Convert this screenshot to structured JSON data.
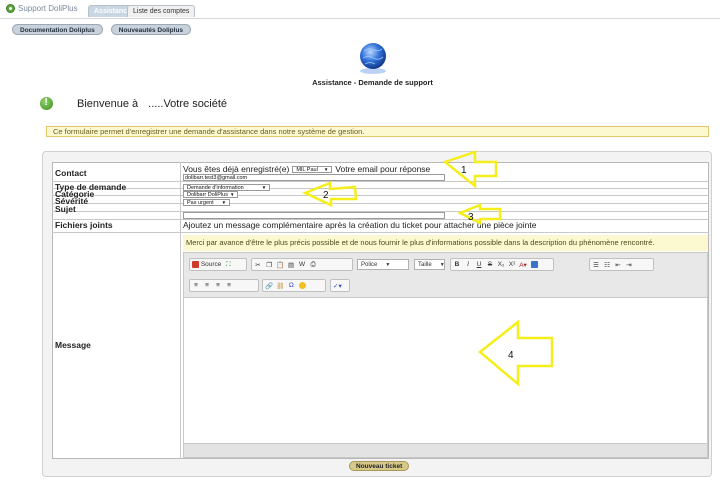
{
  "brand": {
    "name": "Support DoliPlus"
  },
  "tabs": [
    {
      "label": "Assistance",
      "active": true
    },
    {
      "label": "Liste des comptes",
      "active": false
    }
  ],
  "subnav": [
    {
      "label": "Documentation Doliplus"
    },
    {
      "label": "Nouveautés Doliplus"
    }
  ],
  "page_title": "Assistance - Demande de support",
  "welcome": {
    "prefix": "Bienvenue à",
    "company": ".....Votre société"
  },
  "info_message": "Ce formulaire permet d'enregistrer une demande d'assistance dans notre système de gestion.",
  "form": {
    "contact": {
      "label": "Contact",
      "registered_text": "Vous êtes déjà enregistré(e)",
      "selected_user": "MIL Paul",
      "email_label": "Votre email pour réponse",
      "email_value": "dolibarr.test3@gmail.com"
    },
    "request_type": {
      "label": "Type de demande",
      "value": "Demande d'information"
    },
    "category": {
      "label": "Catégorie",
      "value": "Dolibarr DoliPlus"
    },
    "severity": {
      "label": "Sévérité",
      "value": "Pas urgent"
    },
    "subject": {
      "label": "Sujet",
      "value": ""
    },
    "attachments": {
      "label": "Fichiers joints",
      "note": "Ajoutez un message complémentaire après la création du ticket pour attacher une pièce jointe"
    },
    "message": {
      "label": "Message",
      "note": "Merci par avance d'être le plus précis possible et de nous fournir le plus d'informations possible dans la description du phénomène rencontré.",
      "toolbar": {
        "source_label": "Source",
        "font_label": "Police",
        "size_label": "Taille",
        "bold": "B",
        "italic": "I",
        "underline": "U",
        "strike": "S",
        "subscript": "X₂",
        "superscript": "X²"
      }
    }
  },
  "submit_label": "Nouveau ticket",
  "annotations": [
    "1",
    "2",
    "3",
    "4"
  ],
  "colors": {
    "accent_green": "#5aa53c",
    "info_bg": "#fcf8d0",
    "arrow_yellow": "#f5ee1a",
    "tab_active": "#c9d6e3"
  }
}
